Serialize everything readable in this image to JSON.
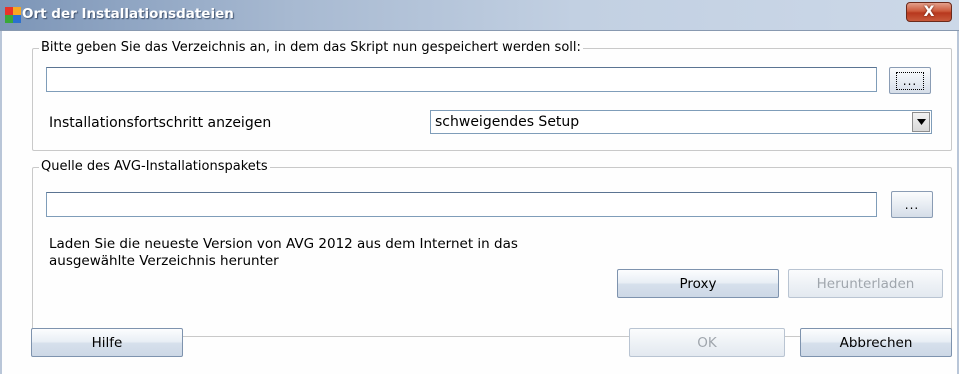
{
  "window": {
    "title": "Ort der Installationsdateien",
    "close_symbol": "X"
  },
  "script_location": {
    "legend": "Bitte geben Sie das Verzeichnis an, in dem das Skript nun gespeichert werden soll:",
    "path_value": "",
    "browse_label": "...",
    "progress_label": "Installationsfortschritt anzeigen",
    "progress_selected": "schweigendes Setup"
  },
  "package_source": {
    "legend": "Quelle des AVG-Installationspakets",
    "path_value": "",
    "browse_label": "...",
    "description_line1": "Laden Sie die neueste Version von AVG 2012 aus dem Internet in das",
    "description_line2": "ausgewählte Verzeichnis herunter",
    "proxy_label": "Proxy",
    "download_label": "Herunterladen"
  },
  "footer": {
    "help_label": "Hilfe",
    "ok_label": "OK",
    "cancel_label": "Abbrechen"
  },
  "icons": {
    "app": "avg-app-icon",
    "close": "close-icon",
    "dropdown": "chevron-down-icon"
  },
  "colors": {
    "titlebar_start": "#7c95b7",
    "titlebar_end": "#ccd8e8",
    "close_button": "#c8593b",
    "disabled_text": "#a0a6ad"
  }
}
